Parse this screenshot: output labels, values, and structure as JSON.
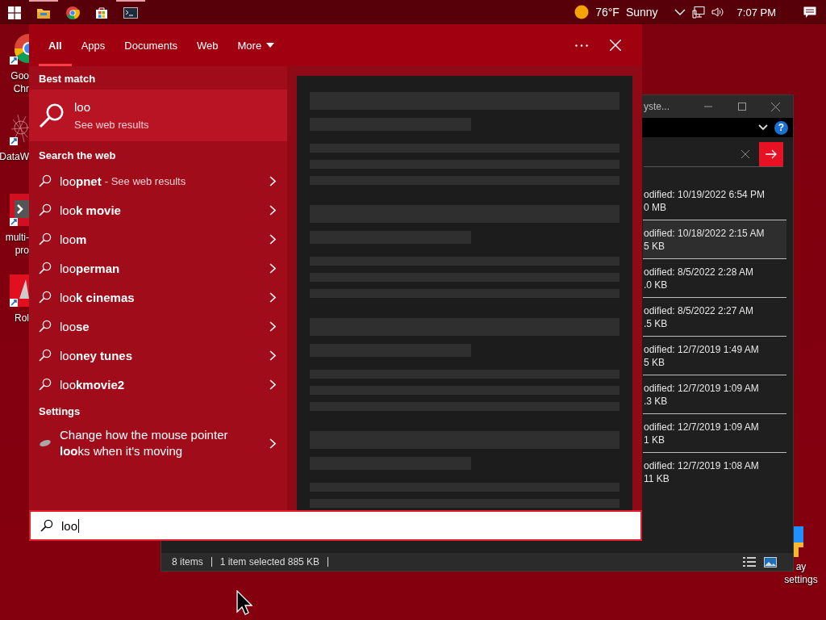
{
  "taskbar": {
    "apps": [
      {
        "kind": "folder",
        "running": true
      },
      {
        "kind": "browser",
        "running": false
      },
      {
        "kind": "store",
        "running": false
      },
      {
        "kind": "terminal",
        "running": true
      }
    ],
    "weather": {
      "temperature": "76°F",
      "condition": "Sunny"
    },
    "clock": "7:07 PM"
  },
  "desktop_icons": [
    {
      "kind": "browser",
      "lines": [
        "Goo",
        "Chr"
      ]
    },
    {
      "kind": "web",
      "lines": [
        "DataW"
      ]
    },
    {
      "kind": "terminal",
      "lines": [
        "multi-",
        "pro"
      ]
    },
    {
      "kind": "pdf",
      "lines": [
        "Rol"
      ]
    },
    {
      "kind": "display",
      "lines": [
        "ay",
        "settings"
      ]
    }
  ],
  "explorer": {
    "title": "yste...",
    "help": "?",
    "rows": [
      {
        "modified": "odified: 10/19/2022 6:54 PM",
        "size": "0 MB",
        "selected": false
      },
      {
        "modified": "odified: 10/18/2022 2:15 AM",
        "size": "5 KB",
        "selected": true
      },
      {
        "modified": "odified: 8/5/2022 2:28 AM",
        "size": ".0 KB",
        "selected": false
      },
      {
        "modified": "odified: 8/5/2022 2:27 AM",
        "size": ".5 KB",
        "selected": false
      },
      {
        "modified": "odified: 12/7/2019 1:49 AM",
        "size": "5 KB",
        "selected": false
      },
      {
        "modified": "odified: 12/7/2019 1:09 AM",
        "size": ".3 KB",
        "selected": false
      },
      {
        "modified": "odified: 12/7/2019 1:09 AM",
        "size": "1 KB",
        "selected": false
      },
      {
        "modified": "odified: 12/7/2019 1:08 AM",
        "size": "11 KB",
        "selected": false
      }
    ],
    "status": [
      "8 items",
      "1 item selected  885 KB"
    ]
  },
  "search": {
    "tabs": [
      {
        "label": "All",
        "selected": true
      },
      {
        "label": "Apps",
        "selected": false
      },
      {
        "label": "Documents",
        "selected": false
      },
      {
        "label": "Web",
        "selected": false
      },
      {
        "label": "More",
        "selected": false
      }
    ],
    "best_match": {
      "heading": "Best match",
      "title": "loo",
      "subtitle": "See web results"
    },
    "web_heading": "Search the web",
    "web_results": [
      {
        "query": "loo**pnet**",
        "suffix": "- See web results"
      },
      {
        "query": "loo**k movie**"
      },
      {
        "query": "loo**m**"
      },
      {
        "query": "loo**perman**"
      },
      {
        "query": "loo**k cinemas**"
      },
      {
        "query": "loo**se**"
      },
      {
        "query": "loo**ney tunes**"
      },
      {
        "query": "loo**kmovie2**"
      }
    ],
    "settings_heading": "Settings",
    "settings_results": [
      {
        "text": "Change how the mouse pointer **loo**ks when it's moving"
      }
    ],
    "query": "loo"
  }
}
